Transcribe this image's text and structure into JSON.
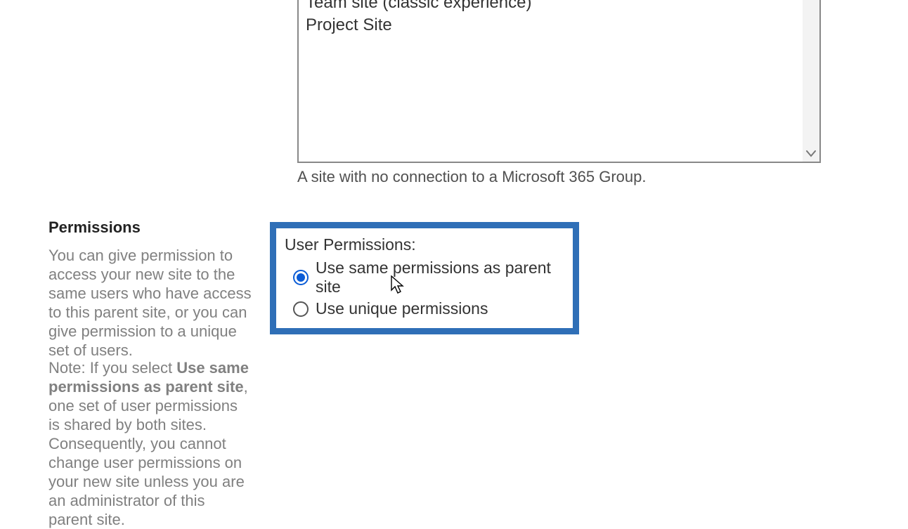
{
  "template_select": {
    "items": [
      "Team site (classic experience)",
      "Project Site"
    ],
    "description": "A site with no connection to a Microsoft 365 Group."
  },
  "permissions": {
    "heading": "Permissions",
    "body": "You can give permission to access your new site to the same users who have access to this parent site, or you can give permission to a unique set of users.",
    "note_prefix": "Note: If you select ",
    "note_bold": "Use same permissions as parent site",
    "note_suffix": ", one set of user permissions is shared by both sites. Consequently, you cannot change user permissions on your new site unless you are an administrator of this parent site.",
    "field_label": "User Permissions:",
    "option_same": "Use same permissions as parent site",
    "option_unique": "Use unique permissions",
    "selected": "same"
  }
}
